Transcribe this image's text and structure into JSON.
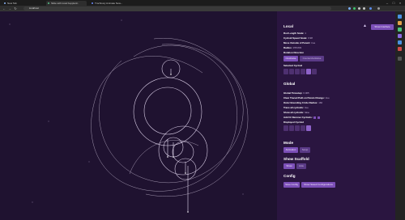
{
  "browser": {
    "tabs": [
      {
        "label": "New Tab",
        "active": false,
        "color": "#8ab4f8"
      },
      {
        "label": "Slide with local Kepplerin",
        "active": true,
        "color": "#55c28a"
      },
      {
        "label": "Trochnary Animate New...",
        "active": false,
        "color": "#6f8cff"
      }
    ],
    "url": "localhost",
    "window_controls": [
      "–",
      "□",
      "×"
    ]
  },
  "sidebar": {
    "top_button": "Show Interface",
    "local": {
      "heading": "Local",
      "params": [
        {
          "label": "Rod Length Scale:",
          "value": "1"
        },
        {
          "label": "Cycloid Speed Scale:",
          "value": "0.98"
        },
        {
          "label": "Move Outside of Parent:",
          "value": "true"
        },
        {
          "label": "Radius:",
          "value": "155.833"
        },
        {
          "label": "Rotation Direction",
          "value": ""
        }
      ],
      "rotation_buttons": [
        "Clockwise",
        "Counterclockwise"
      ],
      "selected_cycloid_label": "Selected Cycloid",
      "cycloid_count": 6,
      "selected_index": 4
    },
    "global": {
      "heading": "Global",
      "params": [
        {
          "label": "Global Timestep:",
          "value": "0.005"
        },
        {
          "label": "Clear Traced Path on Param Change:",
          "value": "true"
        },
        {
          "label": "Outer Bounding Circle Radius:",
          "value": "160"
        },
        {
          "label": "Trace all cycloids:",
          "value": "true"
        },
        {
          "label": "Show all cycloids:",
          "value": "false"
        },
        {
          "label": "Add Or Remove Cycloids:",
          "value": ""
        }
      ],
      "displayed_cycloid_label": "Displayed Cycloid",
      "displayed_count": 5,
      "displayed_index": 4
    },
    "mode": {
      "heading": "Mode",
      "buttons": [
        "Animation",
        "Setup"
      ]
    },
    "scaffold": {
      "heading": "Show Scaffold",
      "buttons": [
        "Show",
        "Hide"
      ]
    },
    "config": {
      "heading": "Config",
      "buttons": [
        "Save Config",
        "Show Saved Configurations"
      ]
    }
  },
  "colors": {
    "bg": "#1f1230",
    "sidebar": "#2a1540",
    "accent": "#7c4fb8",
    "trace": "#cfc3da"
  }
}
